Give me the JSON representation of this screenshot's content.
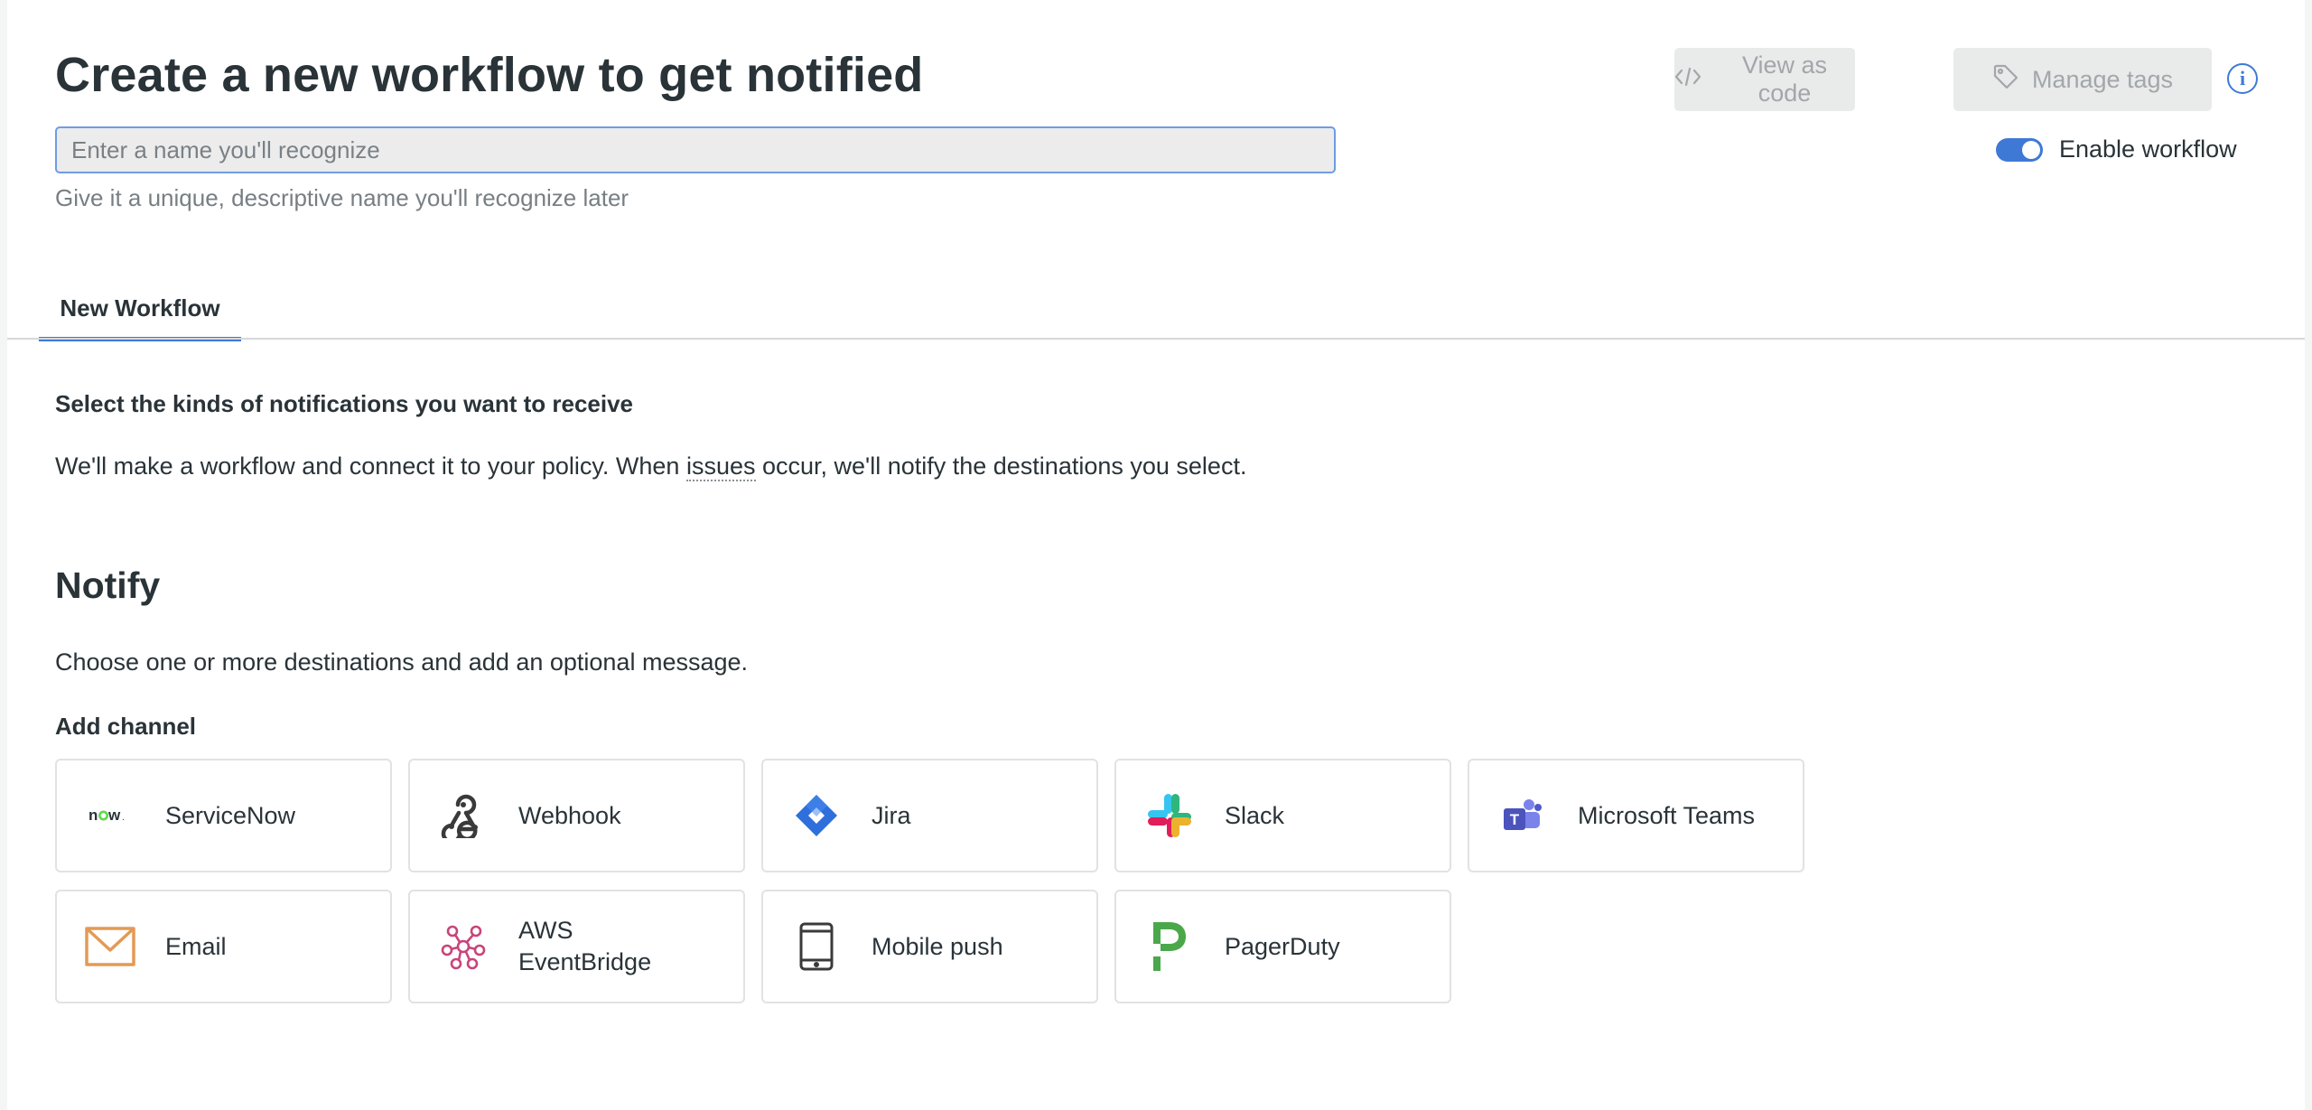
{
  "header": {
    "title": "Create a new workflow to get notified",
    "name_placeholder": "Enter a name you'll recognize",
    "name_value": "",
    "hint": "Give it a unique, descriptive name you'll recognize later",
    "view_as_code": "View as code",
    "manage_tags": "Manage tags",
    "info_icon": "i",
    "enable_label": "Enable workflow",
    "enable_on": true
  },
  "tabs": [
    {
      "label": "New Workflow",
      "active": true
    }
  ],
  "section": {
    "heading": "Select the kinds of notifications you want to receive",
    "desc_before": "We'll make a workflow and connect it to your policy. When ",
    "desc_link": "issues",
    "desc_after": " occur, we'll notify the destinations you select."
  },
  "notify": {
    "title": "Notify",
    "description": "Choose one or more destinations and add an optional message.",
    "add_channel": "Add channel",
    "channels": [
      {
        "label": "ServiceNow",
        "icon": "servicenow-icon"
      },
      {
        "label": "Webhook",
        "icon": "webhook-icon"
      },
      {
        "label": "Jira",
        "icon": "jira-icon"
      },
      {
        "label": "Slack",
        "icon": "slack-icon"
      },
      {
        "label": "Microsoft Teams",
        "icon": "teams-icon"
      },
      {
        "label": "Email",
        "icon": "email-icon"
      },
      {
        "label_line1": "AWS",
        "label_line2": "EventBridge",
        "icon": "eventbridge-icon"
      },
      {
        "label": "Mobile push",
        "icon": "mobile-icon"
      },
      {
        "label": "PagerDuty",
        "icon": "pagerduty-icon"
      }
    ]
  },
  "colors": {
    "accent": "#3f79d6",
    "jira": "#2684ff",
    "email": "#e8a05c",
    "pagerduty": "#4aa84a",
    "eventbridge": "#c7457b",
    "teams": "#5b5fc7"
  }
}
